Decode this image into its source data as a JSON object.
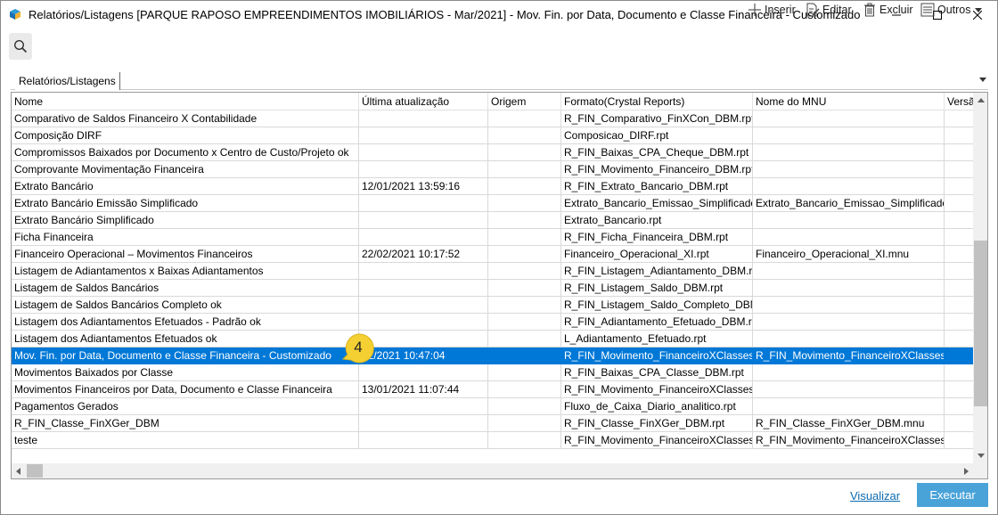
{
  "window": {
    "title": "Relatórios/Listagens [PARQUE RAPOSO EMPREENDIMENTOS IMOBILIÁRIOS - Mar/2021]  - Mov. Fin. por Data, Documento e Classe Financeira - Customizado",
    "icon": "app-cube-icon"
  },
  "toolbar": {
    "insert_label": "Inserir",
    "edit_label": "Editar",
    "delete_label": "Excluir",
    "other_label": "Outros"
  },
  "tabs": [
    {
      "label": "Relatórios/Listagens"
    }
  ],
  "grid": {
    "columns": [
      "Nome",
      "Última atualização",
      "Origem",
      "Formato(Crystal Reports)",
      "Nome do MNU",
      "Versã"
    ],
    "rows": [
      {
        "nome": "Comparativo de Saldos Financeiro X Contabilidade",
        "atualizacao": "",
        "origem": "",
        "formato": "R_FIN_Comparativo_FinXCon_DBM.rpt",
        "mnu": "",
        "versao": ""
      },
      {
        "nome": "Composição DIRF",
        "atualizacao": "",
        "origem": "",
        "formato": "Composicao_DIRF.rpt",
        "mnu": "",
        "versao": ""
      },
      {
        "nome": "Compromissos Baixados por Documento x Centro de Custo/Projeto ok",
        "atualizacao": "",
        "origem": "",
        "formato": "R_FIN_Baixas_CPA_Cheque_DBM.rpt",
        "mnu": "",
        "versao": ""
      },
      {
        "nome": "Comprovante Movimentação Financeira",
        "atualizacao": "",
        "origem": "",
        "formato": "R_FIN_Movimento_Financeiro_DBM.rpt",
        "mnu": "",
        "versao": ""
      },
      {
        "nome": "Extrato Bancário",
        "atualizacao": "12/01/2021 13:59:16",
        "origem": "",
        "formato": "R_FIN_Extrato_Bancario_DBM.rpt",
        "mnu": "",
        "versao": ""
      },
      {
        "nome": "Extrato Bancário Emissão Simplificado",
        "atualizacao": "",
        "origem": "",
        "formato": "Extrato_Bancario_Emissao_Simplificado.rpt",
        "mnu": "Extrato_Bancario_Emissao_Simplificado.mnu",
        "versao": ""
      },
      {
        "nome": "Extrato Bancário Simplificado",
        "atualizacao": "",
        "origem": "",
        "formato": "Extrato_Bancario.rpt",
        "mnu": "",
        "versao": ""
      },
      {
        "nome": "Ficha Financeira",
        "atualizacao": "",
        "origem": "",
        "formato": "R_FIN_Ficha_Financeira_DBM.rpt",
        "mnu": "",
        "versao": ""
      },
      {
        "nome": "Financeiro Operacional – Movimentos Financeiros",
        "atualizacao": "22/02/2021 10:17:52",
        "origem": "",
        "formato": "Financeiro_Operacional_XI.rpt",
        "mnu": "Financeiro_Operacional_XI.mnu",
        "versao": ""
      },
      {
        "nome": "Listagem de Adiantamentos x Baixas Adiantamentos",
        "atualizacao": "",
        "origem": "",
        "formato": "R_FIN_Listagem_Adiantamento_DBM.rpt",
        "mnu": "",
        "versao": ""
      },
      {
        "nome": "Listagem de Saldos Bancários",
        "atualizacao": "",
        "origem": "",
        "formato": "R_FIN_Listagem_Saldo_DBM.rpt",
        "mnu": "",
        "versao": ""
      },
      {
        "nome": "Listagem de Saldos Bancários Completo ok",
        "atualizacao": "",
        "origem": "",
        "formato": "R_FIN_Listagem_Saldo_Completo_DBM.rpt",
        "mnu": "",
        "versao": ""
      },
      {
        "nome": "Listagem dos Adiantamentos Efetuados - Padrão ok",
        "atualizacao": "",
        "origem": "",
        "formato": "R_FIN_Adiantamento_Efetuado_DBM.rpt",
        "mnu": "",
        "versao": ""
      },
      {
        "nome": "Listagem dos Adiantamentos Efetuados ok",
        "atualizacao": "",
        "origem": "",
        "formato": "L_Adiantamento_Efetuado.rpt",
        "mnu": "",
        "versao": ""
      },
      {
        "nome": "Mov. Fin. por Data, Documento e Classe Financeira - Customizado",
        "atualizacao": "02/2021 10:47:04",
        "origem": "",
        "formato": "R_FIN_Movimento_FinanceiroXClasses",
        "mnu": "R_FIN_Movimento_FinanceiroXClasses",
        "versao": "",
        "selected": true
      },
      {
        "nome": "Movimentos Baixados por Classe",
        "atualizacao": "",
        "origem": "",
        "formato": "R_FIN_Baixas_CPA_Classe_DBM.rpt",
        "mnu": "",
        "versao": ""
      },
      {
        "nome": "Movimentos Financeiros por Data, Documento e Classe Financeira",
        "atualizacao": "13/01/2021 11:07:44",
        "origem": "",
        "formato": "R_FIN_Movimento_FinanceiroXClasses",
        "mnu": "",
        "versao": ""
      },
      {
        "nome": "Pagamentos Gerados",
        "atualizacao": "",
        "origem": "",
        "formato": "Fluxo_de_Caixa_Diario_analitico.rpt",
        "mnu": "",
        "versao": ""
      },
      {
        "nome": "R_FIN_Classe_FinXGer_DBM",
        "atualizacao": "",
        "origem": "",
        "formato": "R_FIN_Classe_FinXGer_DBM.rpt",
        "mnu": "R_FIN_Classe_FinXGer_DBM.mnu",
        "versao": ""
      },
      {
        "nome": "teste",
        "atualizacao": "",
        "origem": "",
        "formato": "R_FIN_Movimento_FinanceiroXClasses",
        "mnu": "R_FIN_Movimento_FinanceiroXClasses",
        "versao": ""
      }
    ]
  },
  "callout": {
    "label": "4"
  },
  "footer": {
    "view_label": "Visualizar",
    "run_label": "Executar"
  },
  "colors": {
    "selection": "#0078d7",
    "primary_button": "#4aa3d8",
    "link": "#0c6ab0",
    "callout": "#f5d033"
  }
}
